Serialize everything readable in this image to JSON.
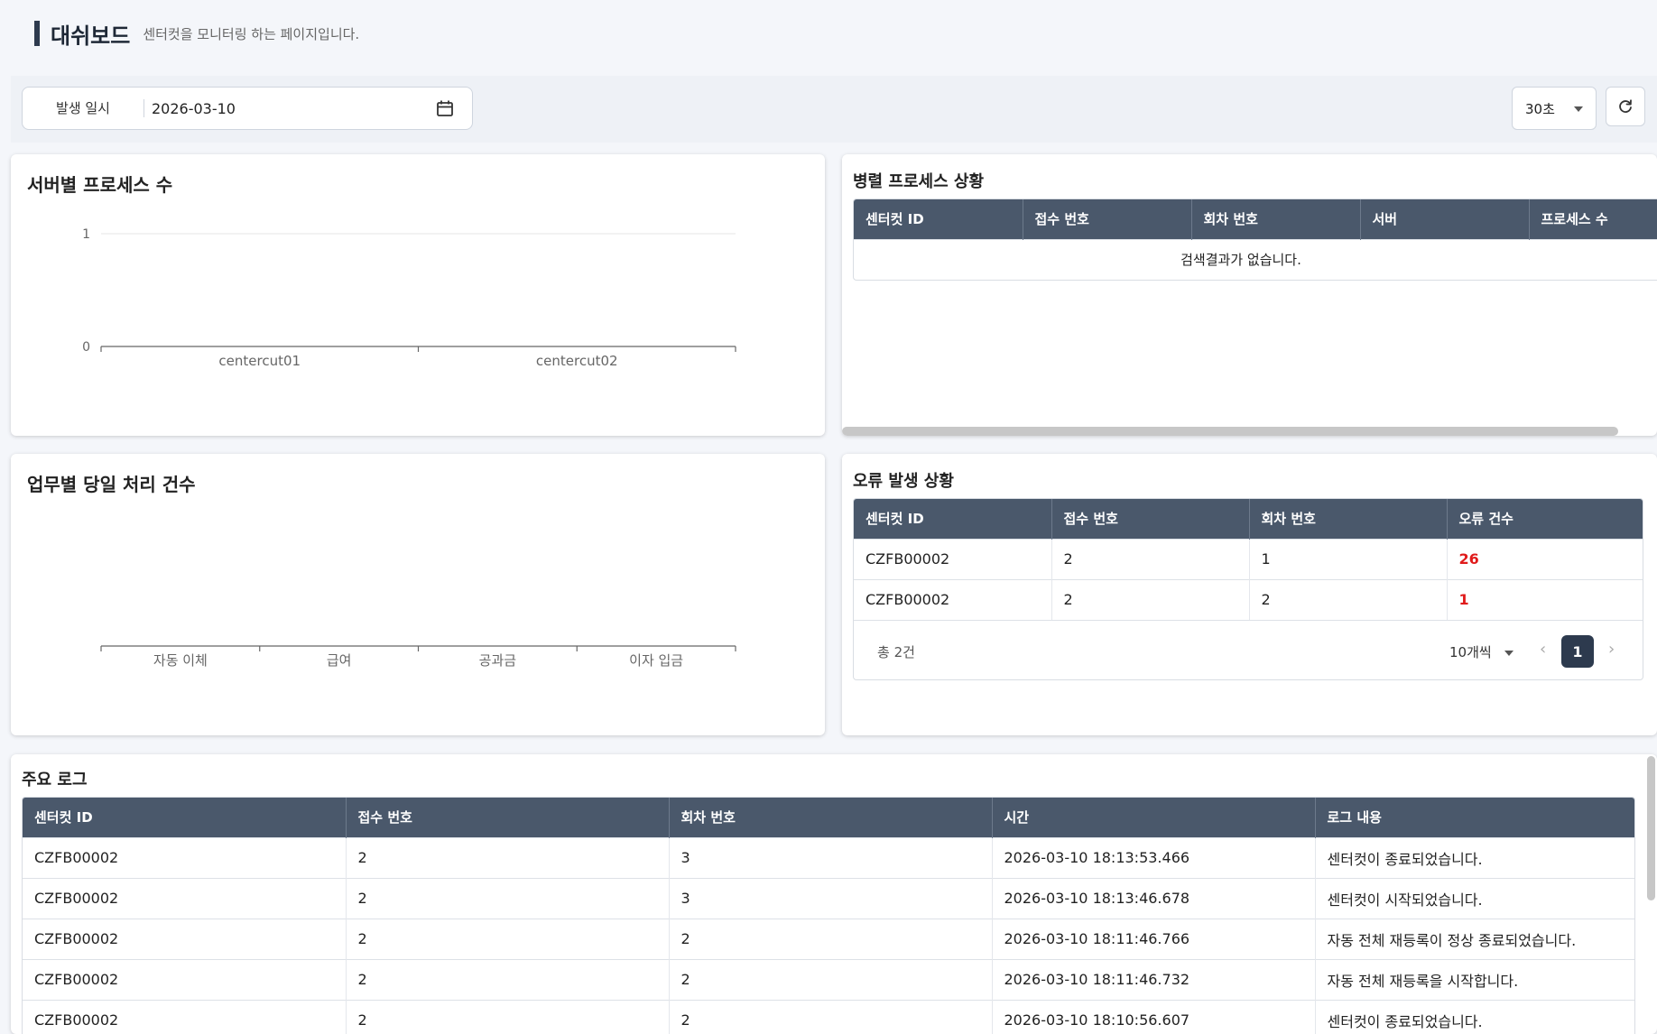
{
  "header": {
    "title": "대쉬보드",
    "subtitle": "센터컷을 모니터링 하는 페이지입니다."
  },
  "filter": {
    "date_label": "발생 일시",
    "date_value": "2026-03-10",
    "interval": "30초"
  },
  "server_process": {
    "title": "서버별 프로세스 수",
    "chart_data": {
      "type": "bar",
      "categories": [
        "centercut01",
        "centercut02"
      ],
      "values": [
        0,
        0
      ],
      "ylim": [
        0,
        1
      ],
      "yticks": [
        "0",
        "1"
      ],
      "grid": true
    }
  },
  "parallel_process": {
    "title": "병렬 프로세스 상황",
    "columns": [
      "센터컷 ID",
      "접수 번호",
      "회차 번호",
      "서버",
      "프로세스 수"
    ],
    "empty_text": "검색결과가 없습니다."
  },
  "daily_count": {
    "title": "업무별 당일 처리 건수",
    "chart_data": {
      "type": "bar",
      "categories": [
        "자동 이체",
        "급여",
        "공과금",
        "이자 입금"
      ],
      "values": [
        0,
        0,
        0,
        0
      ]
    }
  },
  "errors": {
    "title": "오류 발생 상황",
    "columns": [
      "센터컷 ID",
      "접수 번호",
      "회차 번호",
      "오류 건수"
    ],
    "rows": [
      [
        "CZFB00002",
        "2",
        "1",
        "26"
      ],
      [
        "CZFB00002",
        "2",
        "2",
        "1"
      ]
    ],
    "total": "총 2건",
    "page_size": "10개씩",
    "current_page": "1"
  },
  "logs": {
    "title": "주요 로그",
    "columns": [
      "센터컷 ID",
      "접수 번호",
      "회차 번호",
      "시간",
      "로그 내용"
    ],
    "rows": [
      [
        "CZFB00002",
        "2",
        "3",
        "2026-03-10 18:13:53.466",
        "센터컷이 종료되었습니다."
      ],
      [
        "CZFB00002",
        "2",
        "3",
        "2026-03-10 18:13:46.678",
        "센터컷이 시작되었습니다."
      ],
      [
        "CZFB00002",
        "2",
        "2",
        "2026-03-10 18:11:46.766",
        "자동 전체 재등록이 정상 종료되었습니다."
      ],
      [
        "CZFB00002",
        "2",
        "2",
        "2026-03-10 18:11:46.732",
        "자동 전체 재등록을 시작합니다."
      ],
      [
        "CZFB00002",
        "2",
        "2",
        "2026-03-10 18:10:56.607",
        "센터컷이 종료되었습니다."
      ]
    ]
  },
  "colors": {
    "header_bg": "#4a586b",
    "accent": "#2d3a4e",
    "error": "#e01b1b"
  }
}
